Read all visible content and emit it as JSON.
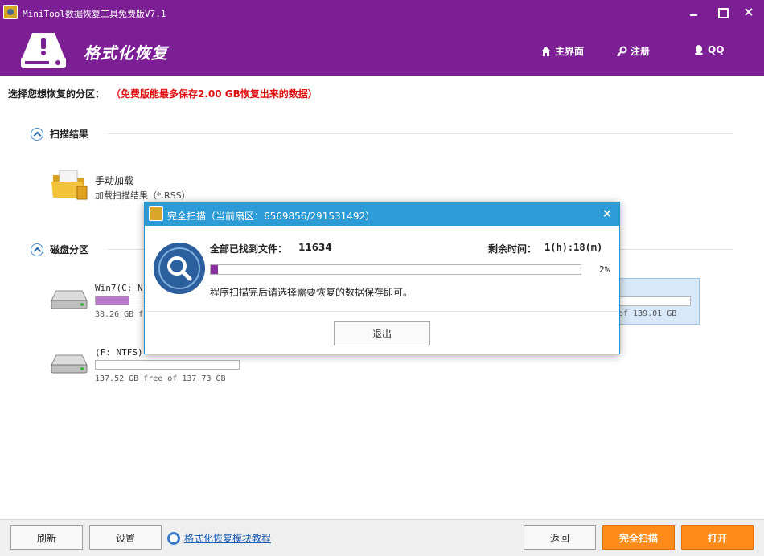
{
  "window": {
    "title": "MiniTool数据恢复工具免费版V7.1",
    "close_glyph": "×"
  },
  "header": {
    "title": "格式化恢复",
    "nav": {
      "home": "主界面",
      "register": "注册",
      "qq": "QQ"
    }
  },
  "prompt": {
    "label": "选择您想恢复的分区：",
    "note": "（免费版能最多保存2.00 GB恢复出来的数据）"
  },
  "scan_results": {
    "heading": "扫描结果",
    "manual_load": {
      "title": "手动加载",
      "subtitle": "加载扫描结果（*.RSS）"
    }
  },
  "partitions": {
    "heading": "磁盘分区",
    "items": [
      {
        "name": "Win7(C: N",
        "size": "38.26 GB fr",
        "used_fraction": 0.23
      },
      {
        "name": "(F: NTFS)",
        "size": "137.52 GB free of 137.73 GB",
        "used_fraction": 0.0
      }
    ],
    "selected_partial": {
      "size": "of 139.01 GB",
      "used_fraction": 0.0
    }
  },
  "dialog": {
    "title": "完全扫描（当前扇区：6569856/291531492）",
    "close_glyph": "×",
    "found_label": "全部已找到文件：",
    "found_value": "11634",
    "remain_label": "剩余时间：",
    "remain_value": "1(h):18(m)",
    "progress_percent": 2,
    "progress_text": "2%",
    "message": "程序扫描完后请选择需要恢复的数据保存即可。",
    "exit_label": "退出"
  },
  "footer": {
    "refresh": "刷新",
    "settings": "设置",
    "tutorial": "格式化恢复模块教程",
    "back": "返回",
    "full_scan": "完全扫描",
    "open": "打开"
  },
  "colors": {
    "brand": "#7c1f95",
    "dialog_title": "#2c9bd6",
    "accent_button": "#ff8c1a",
    "warning_text": "#e01010",
    "progress": "#8b2fa3"
  },
  "icons": {
    "logo": "drive-warning-icon",
    "home": "home-icon",
    "register": "key-icon",
    "qq": "qq-penguin-icon",
    "search": "magnifier-icon",
    "help": "lifebuoy-icon"
  }
}
